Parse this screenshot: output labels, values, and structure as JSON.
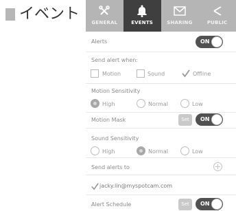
{
  "page": {
    "heading": "イベント"
  },
  "tabs": [
    {
      "label": "GENERAL",
      "icon": "wrench-screwdriver-icon",
      "active": false
    },
    {
      "label": "EVENTS",
      "icon": "bell-icon",
      "active": true
    },
    {
      "label": "SHARING",
      "icon": "envelope-icon",
      "active": false
    },
    {
      "label": "PUBLIC",
      "icon": "share-icon",
      "active": false
    }
  ],
  "alerts": {
    "label": "Alerts",
    "toggle": "ON"
  },
  "send_alert_when": {
    "label": "Send alert when:",
    "options": [
      {
        "label": "Motion",
        "checked": false
      },
      {
        "label": "Sound",
        "checked": false
      },
      {
        "label": "Offline",
        "checked": true
      }
    ]
  },
  "motion_sensitivity": {
    "label": "Motion Sensitivity",
    "options": [
      "High",
      "Normal",
      "Low"
    ],
    "selected": "High"
  },
  "motion_mask": {
    "label": "Motion Mask",
    "set_label": "Set",
    "toggle": "ON"
  },
  "sound_sensitivity": {
    "label": "Sound Sensitivity",
    "options": [
      "High",
      "Normal",
      "Low"
    ],
    "selected": "Normal"
  },
  "send_alerts_to": {
    "label": "Send alerts to",
    "email": "jacky.lin@myspotcam.com",
    "email_checked": true
  },
  "alert_schedule": {
    "label": "Alert Schedule",
    "set_label": "Set",
    "toggle": "ON"
  },
  "colors": {
    "tab_bar": "#b5b5b5",
    "tab_active": "#3f3f3f",
    "toggle_on": "#515151",
    "header_block": "#b7b7b7"
  }
}
